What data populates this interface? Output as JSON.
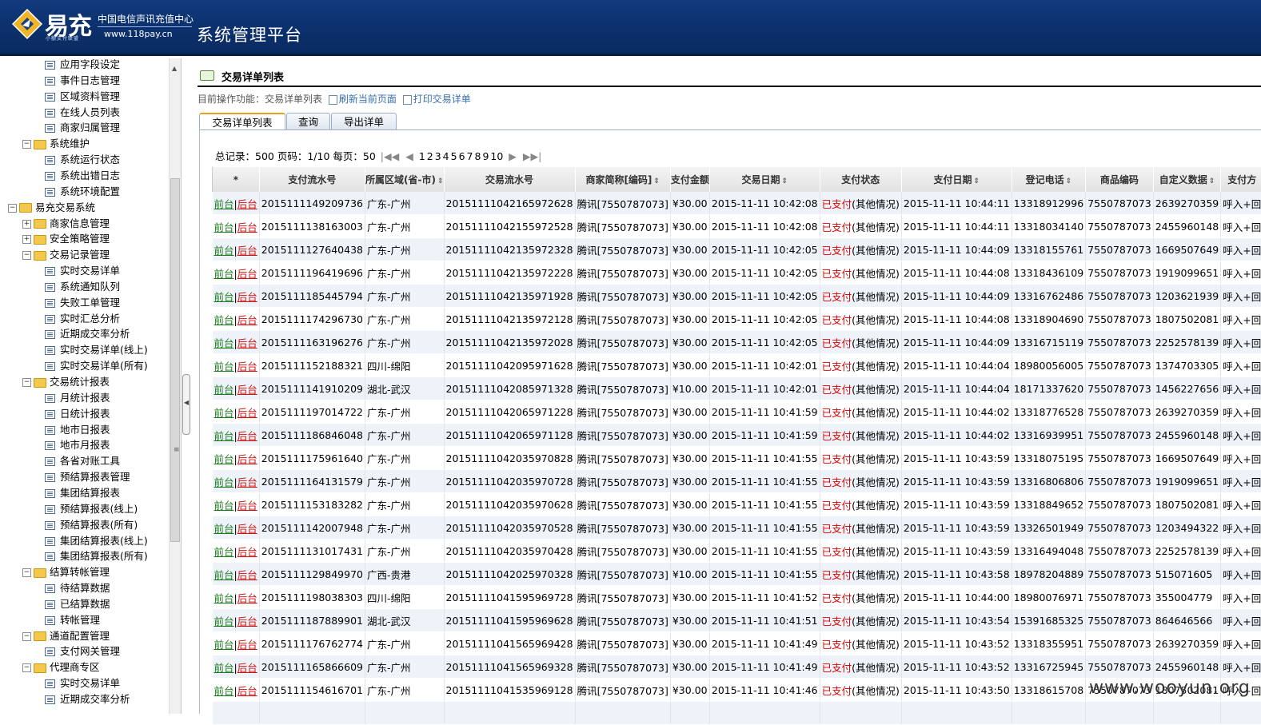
{
  "header": {
    "logo_text": "易充",
    "logo_sub": "小额支付联盟",
    "org_name": "中国电信声讯充值中心",
    "org_url": "www.118pay.cn",
    "platform_title": "系统管理平台"
  },
  "sidebar": {
    "items": [
      {
        "label": "应用字段设定",
        "type": "leaf",
        "level": 2
      },
      {
        "label": "事件日志管理",
        "type": "leaf",
        "level": 2
      },
      {
        "label": "区域资料管理",
        "type": "leaf",
        "level": 2
      },
      {
        "label": "在线人员列表",
        "type": "leaf",
        "level": 2
      },
      {
        "label": "商家归属管理",
        "type": "leaf",
        "level": 2
      },
      {
        "label": "系统维护",
        "type": "folder",
        "level": 1,
        "toggle": "−"
      },
      {
        "label": "系统运行状态",
        "type": "leaf",
        "level": 2
      },
      {
        "label": "系统出错日志",
        "type": "leaf",
        "level": 2
      },
      {
        "label": "系统环境配置",
        "type": "leaf",
        "level": 2
      },
      {
        "label": "易充交易系统",
        "type": "folder",
        "level": 0,
        "toggle": "−"
      },
      {
        "label": "商家信息管理",
        "type": "folder",
        "level": 1,
        "toggle": "+"
      },
      {
        "label": "安全策略管理",
        "type": "folder",
        "level": 1,
        "toggle": "+"
      },
      {
        "label": "交易记录管理",
        "type": "folder",
        "level": 1,
        "toggle": "−"
      },
      {
        "label": "实时交易详单",
        "type": "leaf",
        "level": 2
      },
      {
        "label": "系统通知队列",
        "type": "leaf",
        "level": 2
      },
      {
        "label": "失败工单管理",
        "type": "leaf",
        "level": 2
      },
      {
        "label": "实时汇总分析",
        "type": "leaf",
        "level": 2
      },
      {
        "label": "近期成交率分析",
        "type": "leaf",
        "level": 2
      },
      {
        "label": "实时交易详单(线上)",
        "type": "leaf",
        "level": 2
      },
      {
        "label": "实时交易详单(所有)",
        "type": "leaf",
        "level": 2
      },
      {
        "label": "交易统计报表",
        "type": "folder",
        "level": 1,
        "toggle": "−"
      },
      {
        "label": "月统计报表",
        "type": "leaf",
        "level": 2
      },
      {
        "label": "日统计报表",
        "type": "leaf",
        "level": 2
      },
      {
        "label": "地市日报表",
        "type": "leaf",
        "level": 2
      },
      {
        "label": "地市月报表",
        "type": "leaf",
        "level": 2
      },
      {
        "label": "各省对账工具",
        "type": "leaf",
        "level": 2
      },
      {
        "label": "预结算报表管理",
        "type": "leaf",
        "level": 2
      },
      {
        "label": "集团结算报表",
        "type": "leaf",
        "level": 2
      },
      {
        "label": "预结算报表(线上)",
        "type": "leaf",
        "level": 2
      },
      {
        "label": "预结算报表(所有)",
        "type": "leaf",
        "level": 2
      },
      {
        "label": "集团结算报表(线上)",
        "type": "leaf",
        "level": 2
      },
      {
        "label": "集团结算报表(所有)",
        "type": "leaf",
        "level": 2
      },
      {
        "label": "结算转帐管理",
        "type": "folder",
        "level": 1,
        "toggle": "−"
      },
      {
        "label": "待结算数据",
        "type": "leaf",
        "level": 2
      },
      {
        "label": "已结算数据",
        "type": "leaf",
        "level": 2
      },
      {
        "label": "转帐管理",
        "type": "leaf",
        "level": 2
      },
      {
        "label": "通道配置管理",
        "type": "folder",
        "level": 1,
        "toggle": "−"
      },
      {
        "label": "支付网关管理",
        "type": "leaf",
        "level": 2
      },
      {
        "label": "代理商专区",
        "type": "folder",
        "level": 1,
        "toggle": "−"
      },
      {
        "label": "实时交易详单",
        "type": "leaf",
        "level": 2
      },
      {
        "label": "近期成交率分析",
        "type": "leaf",
        "level": 2
      }
    ]
  },
  "main": {
    "page_title": "交易详单列表",
    "breadcrumb_prefix": "目前操作功能：交易详单列表",
    "refresh_label": "刷新当前页面",
    "print_label": "打印交易详单",
    "tabs": [
      "交易详单列表",
      "查询",
      "导出详单"
    ],
    "pager": {
      "summary": "总记录：500 页码：1/10 每页：50",
      "first": "|◀◀",
      "prev": "◀",
      "pages": [
        "1",
        "2",
        "3",
        "4",
        "5",
        "6",
        "7",
        "8",
        "9",
        "10"
      ],
      "next": "▶",
      "last": "▶▶|"
    },
    "columns": [
      "*",
      "支付流水号",
      "所属区域(省-市)",
      "交易流水号",
      "商家简称[编码]",
      "支付金额",
      "交易日期",
      "支付状态",
      "支付日期",
      "登记电话",
      "商品编码",
      "自定义数据",
      "支付方"
    ],
    "sortable": [
      false,
      false,
      true,
      false,
      true,
      false,
      true,
      false,
      true,
      true,
      false,
      true,
      false
    ],
    "action_front": "前台",
    "action_back": "后台",
    "status_paid": "已支付",
    "status_other": "(其他情况)",
    "rows": [
      [
        "2015111149209736",
        "广东-广州",
        "20151111042165972628",
        "腾讯[7550787073]",
        "¥30.00",
        "2015-11-11 10:42:08",
        "2015-11-11 10:44:11",
        "13318912996",
        "7550787073",
        "2639270359",
        "呼入+回"
      ],
      [
        "2015111138163003",
        "广东-广州",
        "20151111042155972528",
        "腾讯[7550787073]",
        "¥30.00",
        "2015-11-11 10:42:08",
        "2015-11-11 10:44:11",
        "13318034140",
        "7550787073",
        "2455960148",
        "呼入+回"
      ],
      [
        "2015111127640438",
        "广东-广州",
        "20151111042135972328",
        "腾讯[7550787073]",
        "¥30.00",
        "2015-11-11 10:42:05",
        "2015-11-11 10:44:09",
        "13318155761",
        "7550787073",
        "1669507649",
        "呼入+回"
      ],
      [
        "2015111196419696",
        "广东-广州",
        "20151111042135972228",
        "腾讯[7550787073]",
        "¥30.00",
        "2015-11-11 10:42:05",
        "2015-11-11 10:44:08",
        "13318436109",
        "7550787073",
        "1919099651",
        "呼入+回"
      ],
      [
        "2015111185445794",
        "广东-广州",
        "20151111042135971928",
        "腾讯[7550787073]",
        "¥30.00",
        "2015-11-11 10:42:05",
        "2015-11-11 10:44:09",
        "13316762486",
        "7550787073",
        "1203621939",
        "呼入+回"
      ],
      [
        "2015111174296730",
        "广东-广州",
        "20151111042135972128",
        "腾讯[7550787073]",
        "¥30.00",
        "2015-11-11 10:42:05",
        "2015-11-11 10:44:08",
        "13318904690",
        "7550787073",
        "1807502081",
        "呼入+回"
      ],
      [
        "2015111163196276",
        "广东-广州",
        "20151111042135972028",
        "腾讯[7550787073]",
        "¥30.00",
        "2015-11-11 10:42:05",
        "2015-11-11 10:44:09",
        "13316715119",
        "7550787073",
        "2252578139",
        "呼入+回"
      ],
      [
        "2015111152188321",
        "四川-绵阳",
        "20151111042095971628",
        "腾讯[7550787073]",
        "¥30.00",
        "2015-11-11 10:42:01",
        "2015-11-11 10:44:04",
        "18980056005",
        "7550787073",
        "1374703305",
        "呼入+回"
      ],
      [
        "2015111141910209",
        "湖北-武汉",
        "20151111042085971328",
        "腾讯[7550787073]",
        "¥10.00",
        "2015-11-11 10:42:01",
        "2015-11-11 10:44:04",
        "18171337620",
        "7550787073",
        "1456227656",
        "呼入+回"
      ],
      [
        "2015111197014722",
        "广东-广州",
        "20151111042065971228",
        "腾讯[7550787073]",
        "¥30.00",
        "2015-11-11 10:41:59",
        "2015-11-11 10:44:02",
        "13318776528",
        "7550787073",
        "2639270359",
        "呼入+回"
      ],
      [
        "2015111186846048",
        "广东-广州",
        "20151111042065971128",
        "腾讯[7550787073]",
        "¥30.00",
        "2015-11-11 10:41:59",
        "2015-11-11 10:44:02",
        "13316939951",
        "7550787073",
        "2455960148",
        "呼入+回"
      ],
      [
        "2015111175961640",
        "广东-广州",
        "20151111042035970828",
        "腾讯[7550787073]",
        "¥30.00",
        "2015-11-11 10:41:55",
        "2015-11-11 10:43:59",
        "13318075195",
        "7550787073",
        "1669507649",
        "呼入+回"
      ],
      [
        "2015111164131579",
        "广东-广州",
        "20151111042035970728",
        "腾讯[7550787073]",
        "¥30.00",
        "2015-11-11 10:41:55",
        "2015-11-11 10:43:59",
        "13316806806",
        "7550787073",
        "1919099651",
        "呼入+回"
      ],
      [
        "2015111153183282",
        "广东-广州",
        "20151111042035970628",
        "腾讯[7550787073]",
        "¥30.00",
        "2015-11-11 10:41:55",
        "2015-11-11 10:43:59",
        "13318849652",
        "7550787073",
        "1807502081",
        "呼入+回"
      ],
      [
        "2015111142007948",
        "广东-广州",
        "20151111042035970528",
        "腾讯[7550787073]",
        "¥30.00",
        "2015-11-11 10:41:55",
        "2015-11-11 10:43:59",
        "13326501949",
        "7550787073",
        "1203494322",
        "呼入+回"
      ],
      [
        "2015111131017431",
        "广东-广州",
        "20151111042035970428",
        "腾讯[7550787073]",
        "¥30.00",
        "2015-11-11 10:41:55",
        "2015-11-11 10:43:59",
        "13316494048",
        "7550787073",
        "2252578139",
        "呼入+回"
      ],
      [
        "2015111129849970",
        "广西-贵港",
        "20151111042025970328",
        "腾讯[7550787073]",
        "¥10.00",
        "2015-11-11 10:41:55",
        "2015-11-11 10:43:58",
        "18978204889",
        "7550787073",
        "515071605",
        "呼入+回"
      ],
      [
        "2015111198038303",
        "四川-绵阳",
        "20151111041595969728",
        "腾讯[7550787073]",
        "¥30.00",
        "2015-11-11 10:41:52",
        "2015-11-11 10:44:00",
        "18980076971",
        "7550787073",
        "355004779",
        "呼入+回"
      ],
      [
        "2015111187889901",
        "湖北-武汉",
        "20151111041595969628",
        "腾讯[7550787073]",
        "¥30.00",
        "2015-11-11 10:41:51",
        "2015-11-11 10:43:54",
        "15391685325",
        "7550787073",
        "864646566",
        "呼入+回"
      ],
      [
        "2015111176762774",
        "广东-广州",
        "20151111041565969428",
        "腾讯[7550787073]",
        "¥30.00",
        "2015-11-11 10:41:49",
        "2015-11-11 10:43:52",
        "13318355951",
        "7550787073",
        "2639270359",
        "呼入+回"
      ],
      [
        "2015111165866609",
        "广东-广州",
        "20151111041565969328",
        "腾讯[7550787073]",
        "¥30.00",
        "2015-11-11 10:41:49",
        "2015-11-11 10:43:52",
        "13316725945",
        "7550787073",
        "2455960148",
        "呼入+回"
      ],
      [
        "2015111154616701",
        "广东-广州",
        "20151111041535969128",
        "腾讯[7550787073]",
        "¥30.00",
        "2015-11-11 10:41:46",
        "2015-11-11 10:43:50",
        "13318615708",
        "7550787073",
        "1807502081",
        "呼入+回"
      ],
      [
        "",
        "",
        "",
        "",
        "",
        "",
        "",
        "",
        "",
        "",
        ""
      ]
    ]
  },
  "watermark": "www.wooyun.org"
}
